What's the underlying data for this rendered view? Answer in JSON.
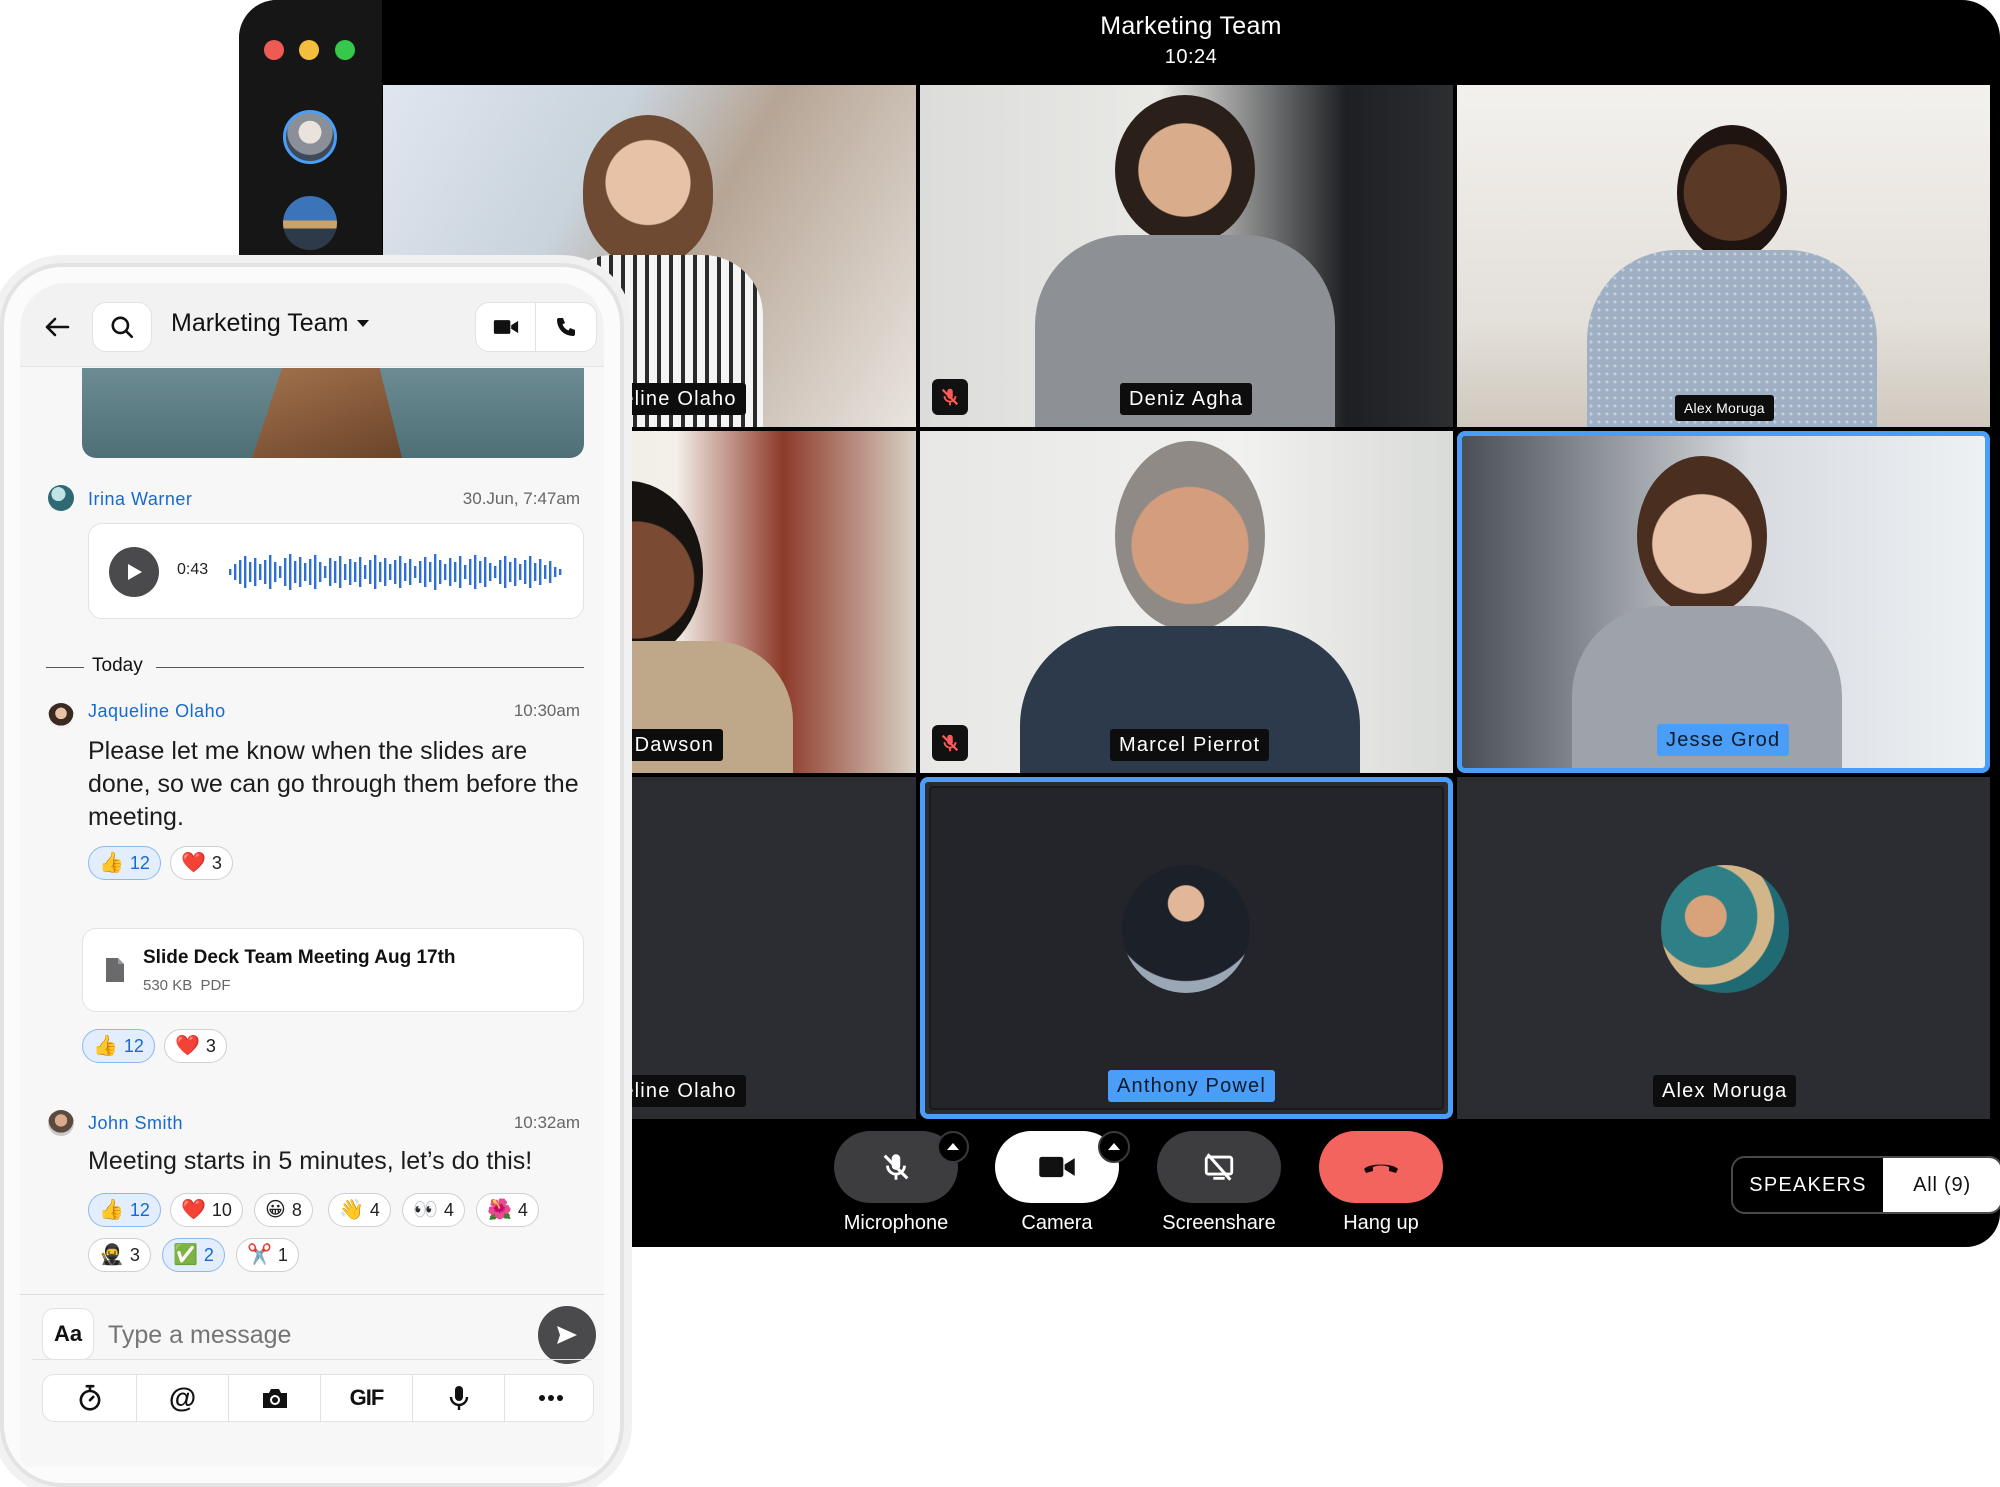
{
  "call": {
    "title": "Marketing Team",
    "time": "10:24",
    "participants": [
      {
        "name": "Jaqueline Olaho",
        "shown_label": "ueline Olaho",
        "muted": false
      },
      {
        "name": "Deniz Agha",
        "muted": true
      },
      {
        "name": "Alex Moruga",
        "muted": false
      },
      {
        "name": "Dawson",
        "shown_label": "m Dawson",
        "muted": false
      },
      {
        "name": "Marcel Pierrot",
        "muted": true
      },
      {
        "name": "Jesse Grod",
        "muted": false,
        "speaking": true
      },
      {
        "name": "Jaqueline Olaho",
        "shown_label": "ueline Olaho",
        "video": false
      },
      {
        "name": "Anthony Powel",
        "video": false,
        "speaking": true
      },
      {
        "name": "Alex Moruga",
        "video": false
      }
    ],
    "controls": {
      "microphone": "Microphone",
      "camera": "Camera",
      "screenshare": "Screenshare",
      "hangup": "Hang up"
    },
    "view_toggle": {
      "speakers": "SPEAKERS",
      "all": "All (9)"
    },
    "colors": {
      "active_border": "#4a9ef7",
      "hangup": "#f3645f"
    }
  },
  "chat": {
    "title": "Marketing Team",
    "messages": [
      {
        "author": "Irina Warner",
        "time": "30.Jun, 7:47am",
        "voice_duration": "0:43"
      },
      {
        "author": "Jaqueline Olaho",
        "time": "10:30am",
        "text": "Please let me know when the slides are done, so we can go through them before the meeting."
      },
      {
        "author": "John Smith",
        "time": "10:32am",
        "text": "Meeting starts in 5 minutes, let’s do this!"
      }
    ],
    "divider": "Today",
    "reactions_a": [
      {
        "emoji": "👍",
        "count": "12"
      },
      {
        "emoji": "❤️",
        "count": "3"
      }
    ],
    "file": {
      "name": "Slide Deck Team Meeting Aug 17th",
      "meta": "530 KB  PDF"
    },
    "reactions_b": [
      {
        "emoji": "👍",
        "count": "12"
      },
      {
        "emoji": "❤️",
        "count": "3"
      }
    ],
    "reactions_c": [
      {
        "emoji": "👍",
        "count": "12"
      },
      {
        "emoji": "❤️",
        "count": "10"
      },
      {
        "emoji": "😀",
        "count": "8"
      },
      {
        "emoji": "👋",
        "count": "4"
      },
      {
        "emoji": "👀",
        "count": "4"
      },
      {
        "emoji": "🌺",
        "count": "4"
      },
      {
        "emoji": "🥷",
        "count": "3"
      },
      {
        "emoji": "✅",
        "count": "2"
      },
      {
        "emoji": "✂️",
        "count": "1"
      }
    ],
    "composer": {
      "format_label": "Aa",
      "placeholder": "Type a message"
    },
    "toolbar": {
      "gif": "GIF"
    }
  }
}
